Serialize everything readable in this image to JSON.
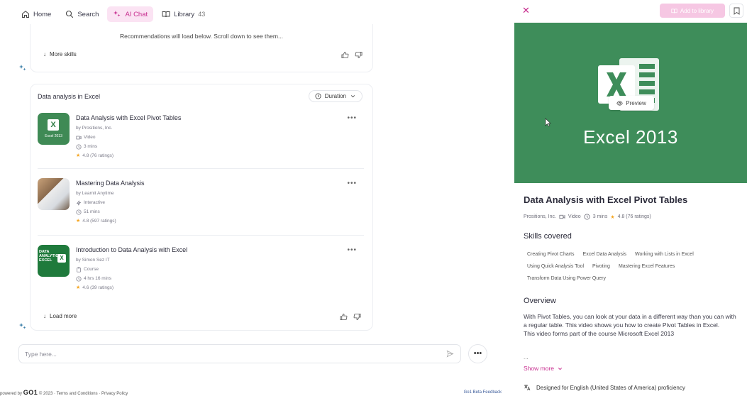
{
  "nav": {
    "home": "Home",
    "search": "Search",
    "ai_chat": "AI Chat",
    "library": "Library",
    "library_count": "43"
  },
  "chat": {
    "recommend_text": "Recommendations will load below. Scroll down to see them...",
    "more_skills": "More skills",
    "section_title": "Data analysis in Excel",
    "duration_label": "Duration",
    "courses": [
      {
        "title": "Data Analysis with Excel Pivot Tables",
        "provider": "by Prositions, Inc.",
        "type": "Video",
        "duration": "3 mins",
        "rating": "4.8 (76 ratings)",
        "thumb_caption": "Excel 2013"
      },
      {
        "title": "Mastering Data Analysis",
        "provider": "by Learnit Anytime",
        "type": "Interactive",
        "duration": "51 mins",
        "rating": "4.8 (597 ratings)"
      },
      {
        "title": "Introduction to Data Analysis with Excel",
        "provider": "by Simon Sez IT",
        "type": "Course",
        "duration": "4 hrs 16 mins",
        "rating": "4.6 (39 ratings)",
        "thumb_text": "DATA ANALYTICS EXCEL"
      }
    ],
    "load_more": "Load more",
    "input_placeholder": "Type here..."
  },
  "footer": {
    "powered_by": "powered by",
    "brand": "GO1",
    "copyright": "© 2023",
    "terms": "Terms and Conditions",
    "privacy": "Privacy Policy",
    "feedback": "Go1 Beta Feedback"
  },
  "panel": {
    "add_to_library": "Add to library",
    "hero_title": "Excel 2013",
    "preview": "Preview",
    "title": "Data Analysis with Excel Pivot Tables",
    "provider": "Prositions, Inc.",
    "type": "Video",
    "duration": "3 mins",
    "rating": "4.8 (76 ratings)",
    "skills_heading": "Skills covered",
    "skills": [
      "Creating Pivot Charts",
      "Excel Data Analysis",
      "Working with Lists in Excel",
      "Using Quick Analysis Tool",
      "Pivoting",
      "Mastering Excel Features",
      "Transform Data Using Power Query"
    ],
    "overview_heading": "Overview",
    "overview_p1": "With Pivot Tables, you can look at your data in a different way than you can with a regular table. This video shows you how to create Pivot Tables in Excel.",
    "overview_p2": "This video forms part of the course Microsoft Excel 2013",
    "overview_ellipsis": "...",
    "show_more": "Show more",
    "designed_for": "Designed for English (United States of America) proficiency"
  },
  "colors": {
    "accent": "#c72c8e",
    "accent_light": "#fbe3f3",
    "excel_green": "#3e8d5a"
  }
}
